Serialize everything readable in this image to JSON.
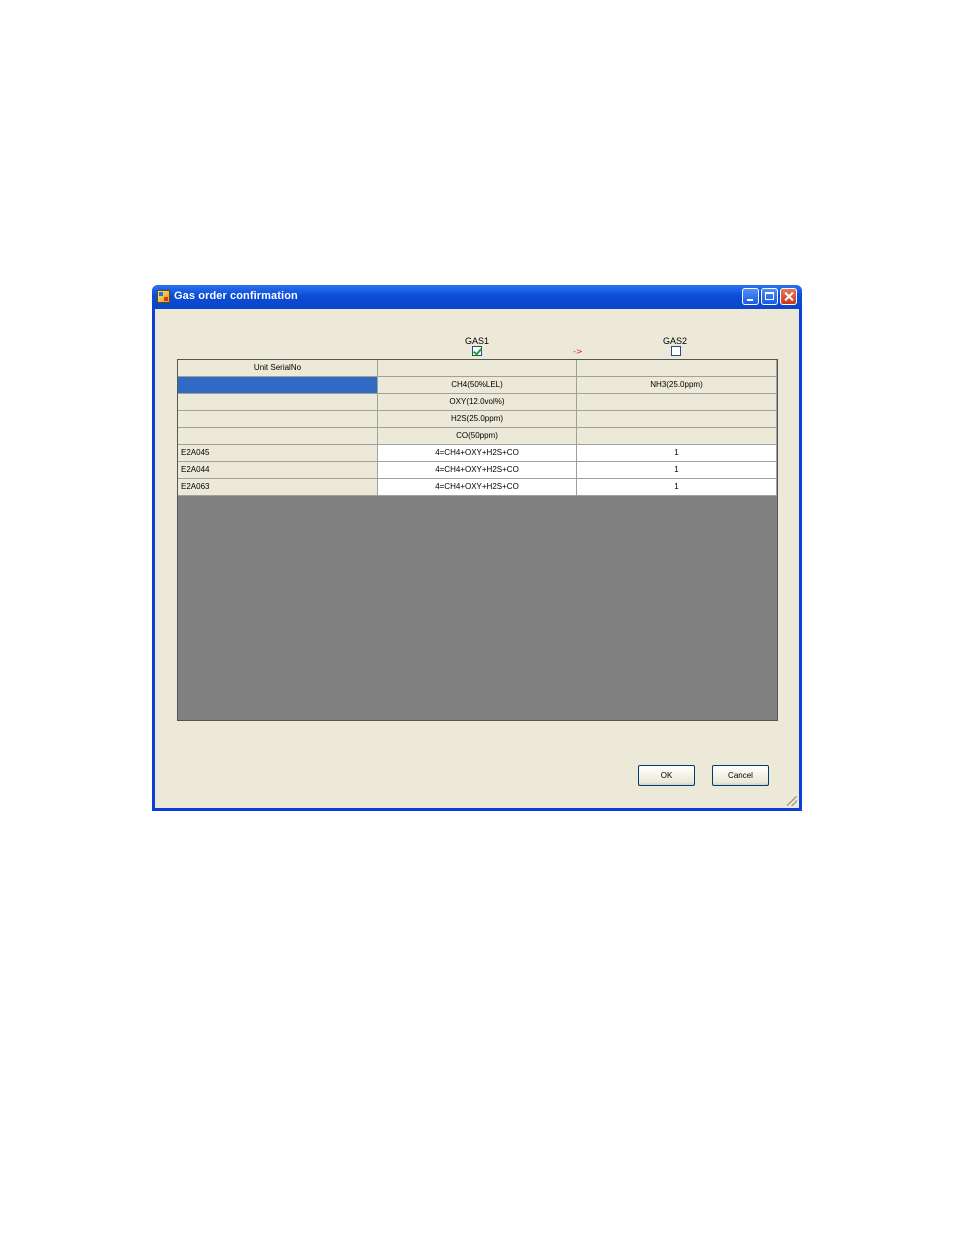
{
  "window": {
    "title": "Gas order confirmation"
  },
  "gas_headers": {
    "gas1_label": "GAS1",
    "gas1_checked": true,
    "gas2_label": "GAS2",
    "gas2_checked": false,
    "arrow": "->"
  },
  "table": {
    "header_row": [
      "Unit SerialNo",
      "",
      ""
    ],
    "gas_rows": [
      [
        "",
        "CH4(50%LEL)",
        "NH3(25.0ppm)"
      ],
      [
        "",
        "OXY(12.0vol%)",
        ""
      ],
      [
        "",
        "H2S(25.0ppm)",
        ""
      ],
      [
        "",
        "CO(50ppm)",
        ""
      ]
    ],
    "unit_rows": [
      [
        "E2A045",
        "4=CH4+OXY+H2S+CO",
        "1"
      ],
      [
        "E2A044",
        "4=CH4+OXY+H2S+CO",
        "1"
      ],
      [
        "E2A063",
        "4=CH4+OXY+H2S+CO",
        "1"
      ]
    ]
  },
  "buttons": {
    "ok": "OK",
    "cancel": "Cancel"
  },
  "colors": {
    "titlebar": "#0a46cb",
    "dialog_bg": "#ece9d8",
    "selection": "#316ac5",
    "grid_empty": "#808080"
  }
}
